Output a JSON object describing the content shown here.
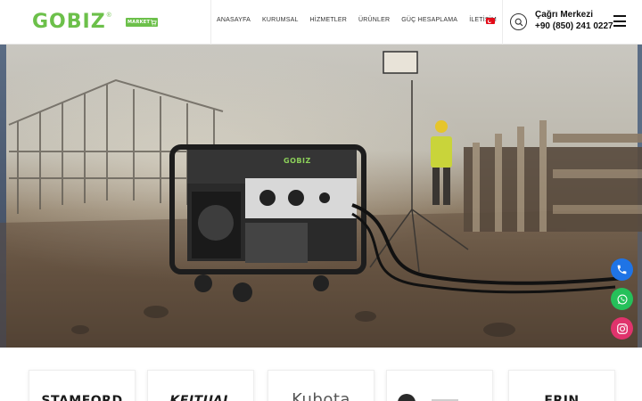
{
  "header": {
    "logo_text": "GOBIZ",
    "logo_mark": "®",
    "market_badge": "MARKET",
    "nav": [
      "ANASAYFA",
      "KURUMSAL",
      "HİZMETLER",
      "ÜRÜNLER",
      "GÜÇ HESAPLAMA",
      "İLETİŞİM"
    ],
    "language_flag": "tr-flag-icon",
    "search_icon": "search-icon",
    "call_center_label": "Çağrı Merkezi",
    "call_center_number": "+90 (850) 241 0227",
    "menu_icon": "hamburger-menu-icon"
  },
  "hero": {
    "generator_brand": "GOBIZ"
  },
  "floating_buttons": [
    {
      "name": "phone-icon",
      "color": "#1f74e6"
    },
    {
      "name": "whatsapp-icon",
      "color": "#25c05a"
    },
    {
      "name": "instagram-icon",
      "color": "#e0336c"
    }
  ],
  "brands": [
    "STAMFORD",
    "KEITUAL",
    "Kubota",
    "",
    "ERIN"
  ],
  "colors": {
    "brand_green": "#6cc04a",
    "text_dark": "#111111"
  }
}
